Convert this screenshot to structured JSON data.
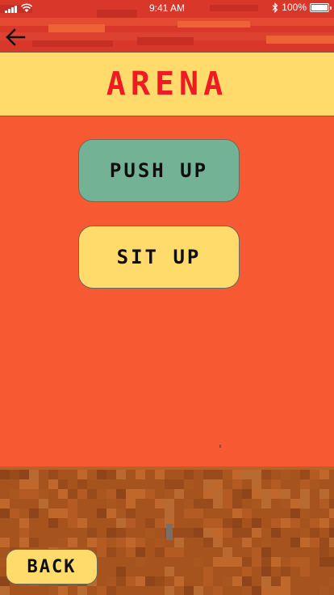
{
  "status_bar": {
    "time": "9:41 AM",
    "battery": "100%",
    "battery_level": 1.0
  },
  "header": {
    "title": "ARENA",
    "back_icon": "arrow-left-icon"
  },
  "options": [
    {
      "label": "PUSH UP",
      "color": "#74b296"
    },
    {
      "label": "SIT UP",
      "color": "#fedb6a"
    }
  ],
  "footer": {
    "back_label": "BACK"
  },
  "colors": {
    "background": "#f75a33",
    "banner": "#fedb6a",
    "title": "#f01a22",
    "ground": "#a6531e"
  }
}
